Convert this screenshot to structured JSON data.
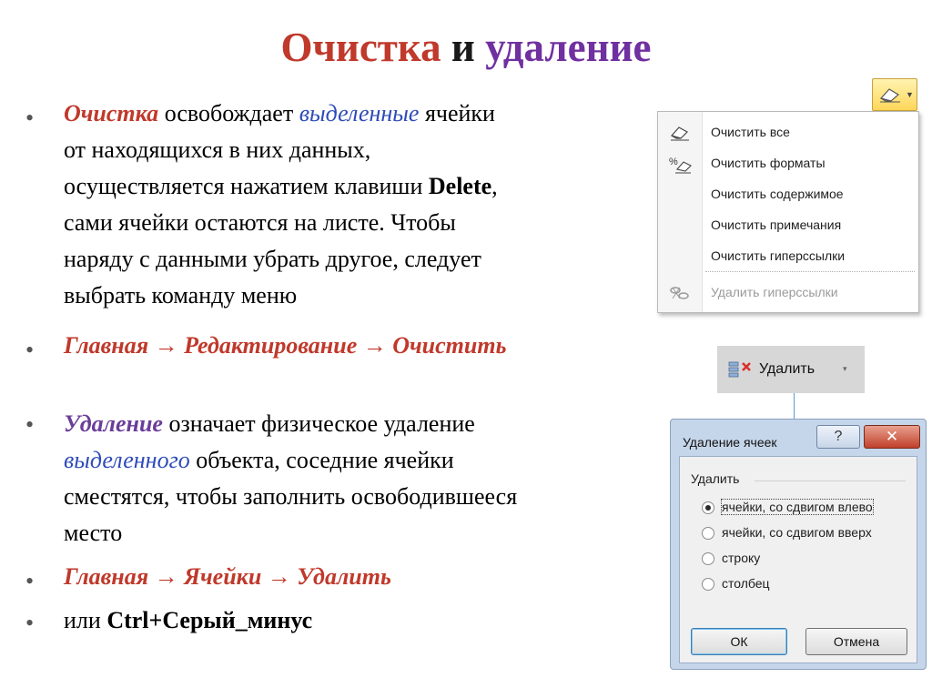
{
  "title": {
    "part1": "Очистка",
    "part2": "и",
    "part3": "удаление"
  },
  "para1": {
    "w1": "Очистка",
    "t1": " освобождает ",
    "w2": "выделенные",
    "t2": " ячейки",
    "l2": "от находящихся в них данных,",
    "l3a": "осуществляется нажатием клавиши ",
    "l3k": "Delete",
    "l3b": ",",
    "l4": "сами ячейки остаются на листе. Чтобы",
    "l5": "наряду с данными убрать другое, следует",
    "l6": "выбрать команду меню"
  },
  "path1": "Главная → Редактирование → Очистить",
  "para2": {
    "w1": "Удаление",
    "t1": " означает физическое удаление",
    "w2": "выделенного",
    "t2": " объекта, соседние ячейки",
    "l3": "сместятся, чтобы заполнить освободившееся",
    "l4": "место"
  },
  "path2": "Главная → Ячейки → Удалить",
  "shortcut": {
    "pre": "или ",
    "key": "Ctrl+Серый_минус"
  },
  "bullet": "•",
  "clear_menu": {
    "items": [
      {
        "label": "Очистить все",
        "icon": "eraser-icon"
      },
      {
        "label": "Очистить форматы",
        "icon": "clear-formats-icon"
      },
      {
        "label": "Очистить содержимое",
        "icon": ""
      },
      {
        "label": "Очистить примечания",
        "icon": ""
      },
      {
        "label": "Очистить гиперссылки",
        "icon": ""
      },
      {
        "label": "Удалить гиперссылки",
        "icon": "remove-link-icon",
        "disabled": true
      }
    ]
  },
  "delete_button": {
    "label": "Удалить",
    "arrow": "▾"
  },
  "dialog": {
    "title": "Удаление ячеек",
    "help": "?",
    "close": "✕",
    "group": "Удалить",
    "options": [
      {
        "label": "ячейки, со сдвигом влево",
        "selected": true
      },
      {
        "label": "ячейки, со сдвигом вверх",
        "selected": false
      },
      {
        "label": "строку",
        "selected": false
      },
      {
        "label": "столбец",
        "selected": false
      }
    ],
    "ok": "ОК",
    "cancel": "Отмена"
  }
}
